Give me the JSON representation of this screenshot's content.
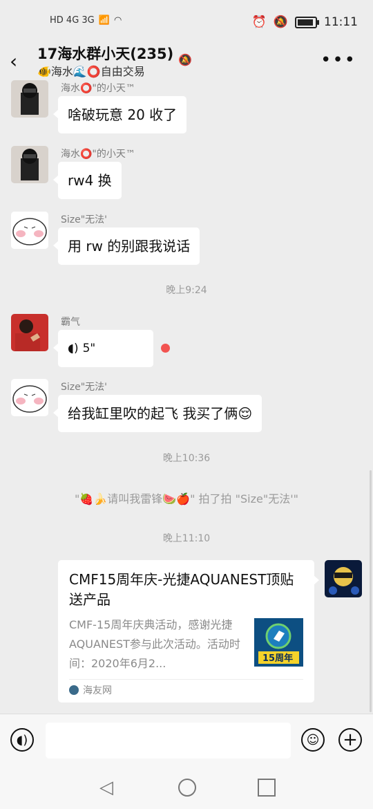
{
  "status_bar": {
    "left_icons": "HD 4G 3G",
    "time": "11:11"
  },
  "header": {
    "title": "17海水群小天(235)",
    "subtitle": "🐠海水🌊⭕自由交易",
    "back_icon": "back-arrow-icon",
    "mute_icon": "bell-off-icon",
    "more_icon": "more-icon"
  },
  "messages": [
    {
      "sender": "海水⭕\"的小天™",
      "text": "啥破玩意 20 收了"
    },
    {
      "sender": "海水⭕\"的小天™",
      "text": "rw4 换"
    },
    {
      "sender": "Size\"无法'",
      "text": "用 rw 的别跟我说话"
    }
  ],
  "time_1": "晚上9:24",
  "voice_message": {
    "sender": "霸气",
    "duration": "5\""
  },
  "message_4": {
    "sender": "Size\"无法'",
    "text": "给我缸里吹的起飞 我买了俩😌"
  },
  "time_2": "晚上10:36",
  "system_notice": "\"🍓🍌请叫我雷锋🍉🍎\" 拍了拍 \"Size\"无法'\"",
  "time_3": "晚上11:10",
  "card": {
    "title": "CMF15周年庆-光捷AQUANEST顶贴送产品",
    "description": "CMF-15周年庆典活动，感谢光捷AQUANEST参与此次活动。活动时间：2020年6月2...",
    "thumb_text": "15周年",
    "source": "海友网"
  },
  "input": {
    "placeholder": ""
  },
  "colors": {
    "background": "#ededed",
    "unread_dot": "#f25350"
  }
}
